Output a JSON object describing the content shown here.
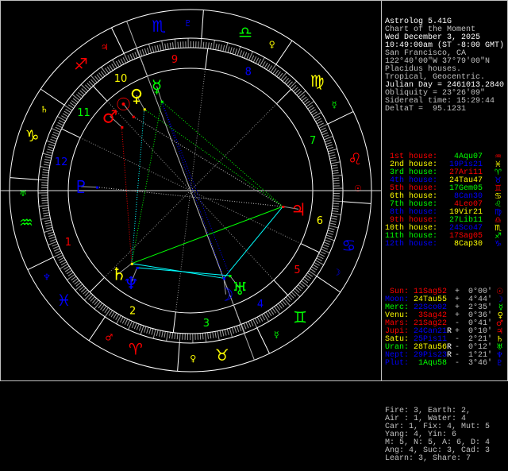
{
  "colors": {
    "red": "#ff0000",
    "yellow": "#ffff00",
    "green": "#00ff00",
    "blue": "#0000ff",
    "white": "#ffffff",
    "gray": "#c0c0c0",
    "cyan": "#00ffff"
  },
  "header": [
    {
      "text": "Astrolog 5.41G",
      "tone": "w"
    },
    {
      "text": "Chart of the Moment",
      "tone": "g"
    },
    {
      "text": "Wed December 3, 2025",
      "tone": "w"
    },
    {
      "text": "10:49:00am (ST -8:00 GMT)",
      "tone": "w"
    },
    {
      "text": "San Francisco, CA",
      "tone": "g"
    },
    {
      "text": "122°40'00\"W 37°79'00\"N",
      "tone": "g"
    },
    {
      "text": "Placidus houses.",
      "tone": "g"
    },
    {
      "text": "Tropical, Geocentric.",
      "tone": "g"
    },
    {
      "text": "Julian Day = 2461013.2840",
      "tone": "w"
    },
    {
      "text": "Obliquity = 23°26'09\"",
      "tone": "g"
    },
    {
      "text": "Sidereal time: 15:29:44",
      "tone": "g"
    },
    {
      "text": "DeltaT =  95.1231",
      "tone": "g"
    }
  ],
  "houses": [
    {
      "label": "1st house:",
      "value": "4Aqu07",
      "lon": 304.12,
      "lc": "red",
      "vc": "green",
      "glyph": "♒"
    },
    {
      "label": "2nd house:",
      "value": "19Pis21",
      "lon": 349.35,
      "lc": "yellow",
      "vc": "blue",
      "glyph": "♓"
    },
    {
      "label": "3rd house:",
      "value": "27Ari11",
      "lon": 27.18,
      "lc": "green",
      "vc": "red",
      "glyph": "♈"
    },
    {
      "label": "4th house:",
      "value": "24Tau47",
      "lon": 54.78,
      "lc": "blue",
      "vc": "yellow",
      "glyph": "♉"
    },
    {
      "label": "5th house:",
      "value": "17Gem05",
      "lon": 77.08,
      "lc": "red",
      "vc": "green",
      "glyph": "♊"
    },
    {
      "label": "6th house:",
      "value": "8Can30",
      "lon": 98.5,
      "lc": "yellow",
      "vc": "blue",
      "glyph": "♋"
    },
    {
      "label": "7th house:",
      "value": "4Leo07",
      "lon": 124.12,
      "lc": "green",
      "vc": "red",
      "glyph": "♌"
    },
    {
      "label": "8th house:",
      "value": "19Vir21",
      "lon": 169.35,
      "lc": "blue",
      "vc": "yellow",
      "glyph": "♍"
    },
    {
      "label": "9th house:",
      "value": "27Lib11",
      "lon": 207.18,
      "lc": "red",
      "vc": "green",
      "glyph": "♎"
    },
    {
      "label": "10th house:",
      "value": "24Sco47",
      "lon": 234.78,
      "lc": "yellow",
      "vc": "blue",
      "glyph": "♏"
    },
    {
      "label": "11th house:",
      "value": "17Sag05",
      "lon": 257.08,
      "lc": "green",
      "vc": "red",
      "glyph": "♐"
    },
    {
      "label": "12th house:",
      "value": "8Cap30",
      "lon": 278.5,
      "lc": "blue",
      "vc": "yellow",
      "glyph": "♑"
    }
  ],
  "house_numbers": [
    "1",
    "2",
    "3",
    "4",
    "5",
    "6",
    "7",
    "8",
    "9",
    "10",
    "11",
    "12"
  ],
  "planets": [
    {
      "name": "Sun:",
      "value": "11Sag52",
      "retro": "",
      "sign": "+",
      "lat": "0°00'",
      "lon": 251.87,
      "nc": "red",
      "vc": "red",
      "glyph": "☉"
    },
    {
      "name": "Moon:",
      "value": "24Tau55",
      "retro": "",
      "sign": "+",
      "lat": "4°44'",
      "lon": 54.92,
      "nc": "blue",
      "vc": "yellow",
      "glyph": "☽"
    },
    {
      "name": "Merc:",
      "value": "22Sco02",
      "retro": "",
      "sign": "+",
      "lat": "2°35'",
      "lon": 232.03,
      "nc": "green",
      "vc": "blue",
      "glyph": "☿"
    },
    {
      "name": "Venu:",
      "value": "3Sag42",
      "retro": "",
      "sign": "+",
      "lat": "0°36'",
      "lon": 243.7,
      "nc": "yellow",
      "vc": "red",
      "glyph": "♀"
    },
    {
      "name": "Mars:",
      "value": "21Sag22",
      "retro": "",
      "sign": "-",
      "lat": "0°41'",
      "lon": 261.37,
      "nc": "red",
      "vc": "red",
      "glyph": "♂"
    },
    {
      "name": "Jupi:",
      "value": "24Can21",
      "retro": "R",
      "sign": "+",
      "lat": "0°10'",
      "lon": 114.35,
      "nc": "red",
      "vc": "blue",
      "glyph": "♃"
    },
    {
      "name": "Satu:",
      "value": "25Pis11",
      "retro": "",
      "sign": "-",
      "lat": "2°21'",
      "lon": 355.18,
      "nc": "yellow",
      "vc": "blue",
      "glyph": "♄"
    },
    {
      "name": "Uran:",
      "value": "28Tau56",
      "retro": "R",
      "sign": "-",
      "lat": "0°12'",
      "lon": 58.93,
      "nc": "green",
      "vc": "yellow",
      "glyph": "♅"
    },
    {
      "name": "Nept:",
      "value": "29Pis23",
      "retro": "R",
      "sign": "-",
      "lat": "1°21'",
      "lon": 359.38,
      "nc": "blue",
      "vc": "blue",
      "glyph": "♆"
    },
    {
      "name": "Plut:",
      "value": "1Aqu58",
      "retro": "",
      "sign": "-",
      "lat": "3°46'",
      "lon": 301.97,
      "nc": "blue",
      "vc": "green",
      "glyph": "♇"
    }
  ],
  "signs": [
    {
      "glyph": "♈",
      "color": "red",
      "ruler": "♂",
      "rc": "red"
    },
    {
      "glyph": "♉",
      "color": "yellow",
      "ruler": "♀",
      "rc": "yellow"
    },
    {
      "glyph": "♊",
      "color": "green",
      "ruler": "☿",
      "rc": "green"
    },
    {
      "glyph": "♋",
      "color": "blue",
      "ruler": "☽",
      "rc": "blue"
    },
    {
      "glyph": "♌",
      "color": "red",
      "ruler": "☉",
      "rc": "red"
    },
    {
      "glyph": "♍",
      "color": "yellow",
      "ruler": "☿",
      "rc": "green"
    },
    {
      "glyph": "♎",
      "color": "green",
      "ruler": "♀",
      "rc": "yellow"
    },
    {
      "glyph": "♏",
      "color": "blue",
      "ruler": "♇",
      "rc": "blue"
    },
    {
      "glyph": "♐",
      "color": "red",
      "ruler": "♃",
      "rc": "red"
    },
    {
      "glyph": "♑",
      "color": "yellow",
      "ruler": "♄",
      "rc": "yellow"
    },
    {
      "glyph": "♒",
      "color": "green",
      "ruler": "♅",
      "rc": "green"
    },
    {
      "glyph": "♓",
      "color": "blue",
      "ruler": "♆",
      "rc": "blue"
    }
  ],
  "aspects": [
    {
      "a": 5,
      "b": 1,
      "color": "cyan",
      "style": "solid"
    },
    {
      "a": 5,
      "b": 6,
      "color": "green",
      "style": "solid"
    },
    {
      "a": 6,
      "b": 1,
      "color": "cyan",
      "style": "solid"
    },
    {
      "a": 8,
      "b": 7,
      "color": "cyan",
      "style": "solid"
    },
    {
      "a": 2,
      "b": 1,
      "color": "blue",
      "style": "dotted"
    },
    {
      "a": 2,
      "b": 7,
      "color": "blue",
      "style": "dotted"
    },
    {
      "a": 3,
      "b": 6,
      "color": "cyan",
      "style": "dotted"
    },
    {
      "a": 2,
      "b": 5,
      "color": "green",
      "style": "dotted"
    },
    {
      "a": 2,
      "b": 6,
      "color": "green",
      "style": "dotted"
    },
    {
      "a": 3,
      "b": 5,
      "color": "green",
      "style": "dotted"
    },
    {
      "a": 4,
      "b": 6,
      "color": "red",
      "style": "dotted"
    },
    {
      "a": 0,
      "b": 5,
      "color": "gray",
      "style": "dotted"
    },
    {
      "a": 9,
      "b": 5,
      "color": "gray",
      "style": "dotted"
    }
  ],
  "summary": [
    "Fire: 3, Earth: 2,",
    "Air : 1, Water: 4",
    "Car: 1, Fix: 4, Mut: 5",
    "Yang: 4, Yin: 6",
    "M: 5, N: 5, A: 6, D: 4",
    "Ang: 4, Suc: 3, Cad: 3",
    "Learn: 3, Share: 7"
  ]
}
